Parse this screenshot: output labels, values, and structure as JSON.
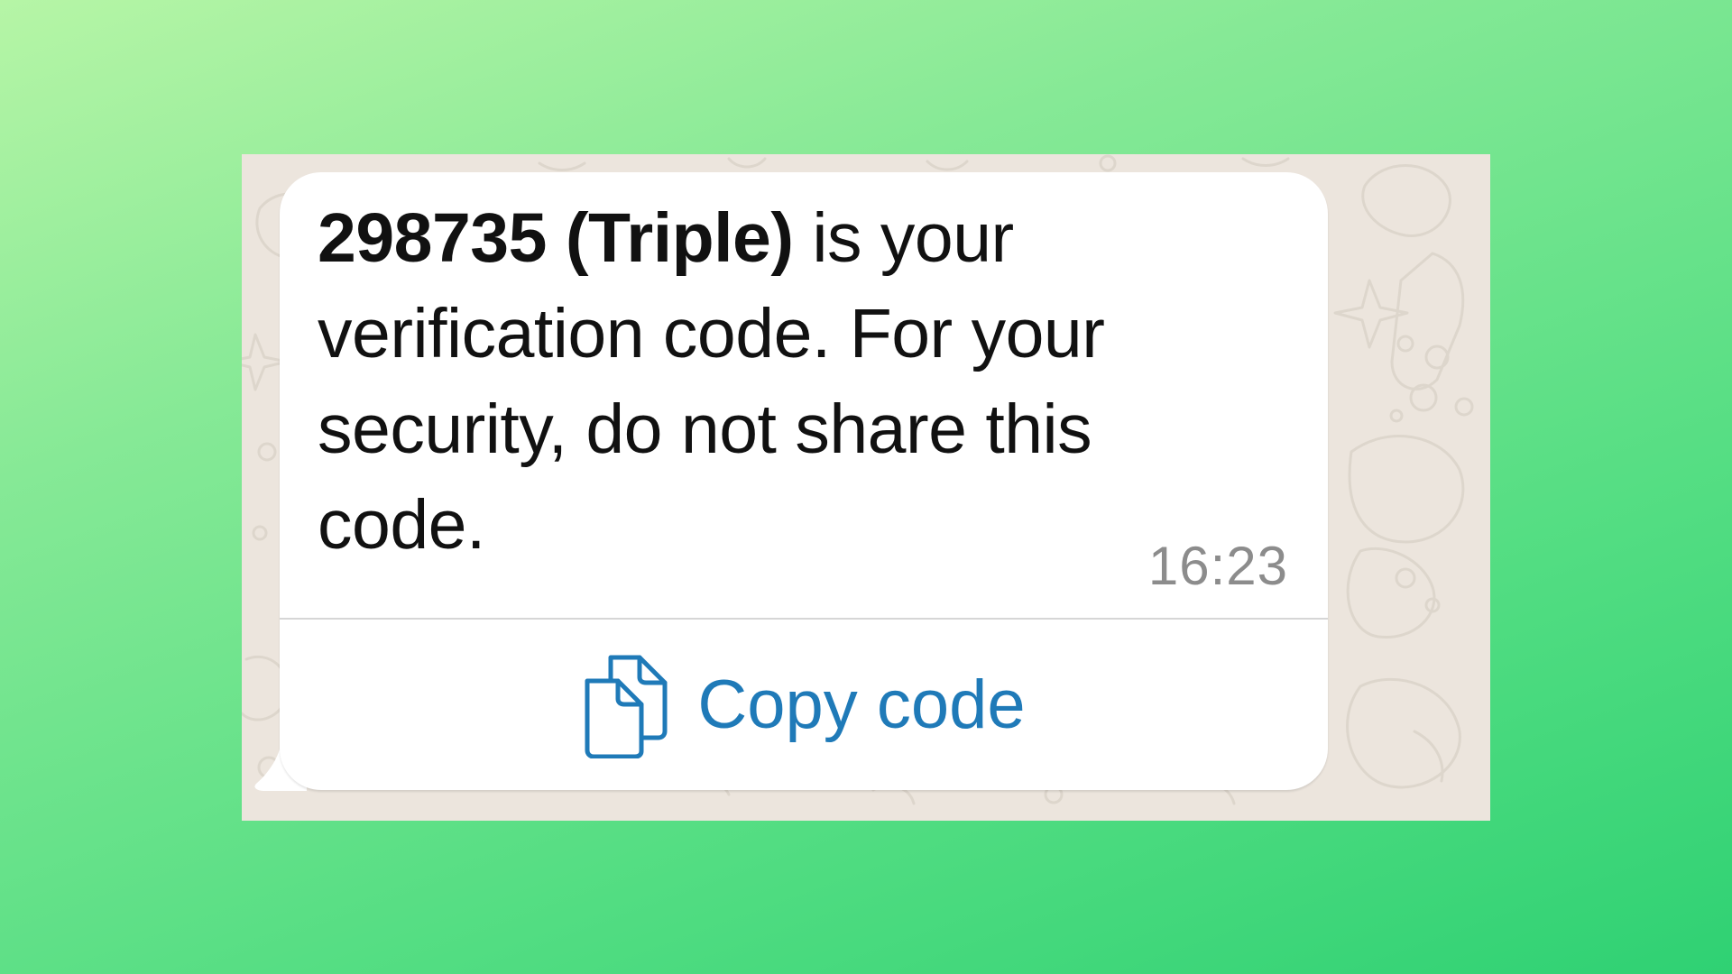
{
  "message": {
    "code": "298735 (Triple)",
    "body": " is your verification code. For your security, do not share this code.",
    "timestamp": "16:23"
  },
  "action": {
    "copy_label": "Copy code",
    "icon": "copy-documents-icon"
  },
  "colors": {
    "background_gradient_start": "#b6f5a6",
    "background_gradient_end": "#2fd173",
    "chat_background": "#ece5dd",
    "bubble": "#ffffff",
    "message_text": "#111111",
    "timestamp": "#8c8c8c",
    "action_blue": "#1f7ab8"
  }
}
